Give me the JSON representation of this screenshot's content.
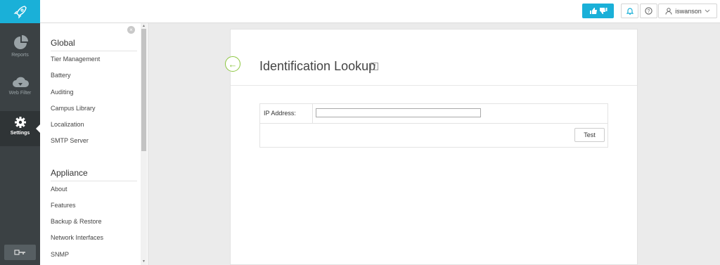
{
  "rail": {
    "items": [
      {
        "label": "Reports",
        "icon": "pie-chart-icon"
      },
      {
        "label": "Web Filter",
        "icon": "cloud-filter-icon"
      },
      {
        "label": "Settings",
        "icon": "gear-icon"
      }
    ],
    "logout_icon": "logout-icon",
    "logo_icon": "rocket-icon",
    "accent_color": "#1ab0d8"
  },
  "topbar": {
    "feedback_icon": "thumbs-up-down-icon",
    "notifications_icon": "bell-icon",
    "help_icon": "question-icon",
    "user": {
      "name": "iswanson",
      "icon": "user-icon",
      "caret": "chevron-down-icon"
    }
  },
  "nav": {
    "sections": [
      {
        "heading": "Global",
        "items": [
          "Tier Management",
          "Battery",
          "Auditing",
          "Campus Library",
          "Localization",
          "SMTP Server"
        ]
      },
      {
        "heading": "Appliance",
        "items": [
          "About",
          "Features",
          "Backup & Restore",
          "Network Interfaces",
          "SNMP"
        ]
      }
    ]
  },
  "page": {
    "title": "Identification Lookup",
    "help_glyph": "?",
    "back_glyph": "←",
    "form": {
      "ip_label": "IP Address:",
      "ip_value": "",
      "test_label": "Test"
    }
  }
}
